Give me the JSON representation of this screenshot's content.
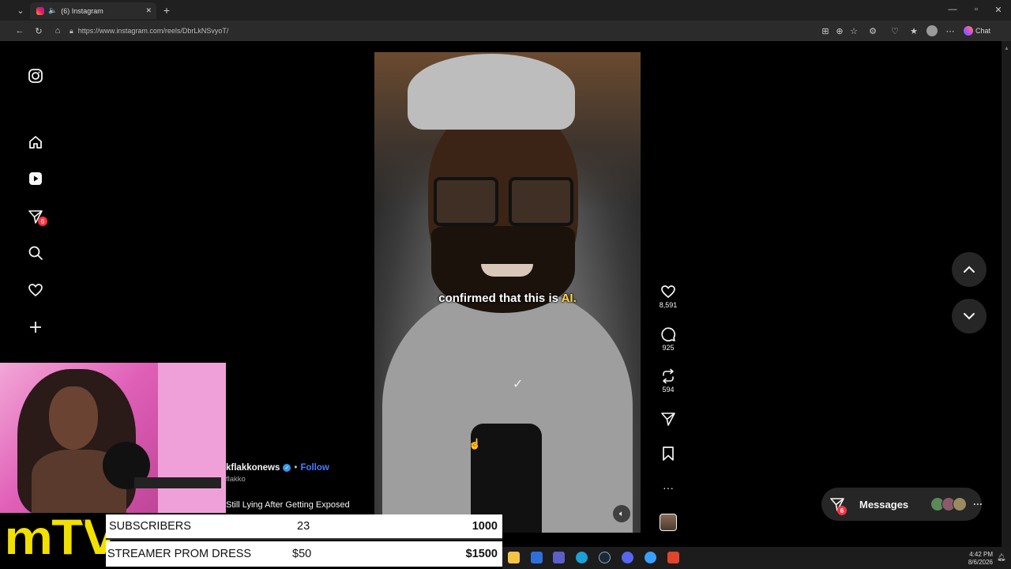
{
  "browser": {
    "tab_title": "(6) Instagram",
    "new_tab_label": "+",
    "url": "https://www.instagram.com/reels/DbrLkNSvyoT/",
    "chat_label": "Chat"
  },
  "sidebar": {
    "notifications_badge": "6"
  },
  "video": {
    "caption_pre": "confirmed that this is ",
    "caption_highlight": "AI."
  },
  "actions": {
    "likes": "8,591",
    "comments": "925",
    "reposts": "594"
  },
  "post": {
    "username": "kflakkonews",
    "follow_label": "Follow",
    "subtitle": "flakko",
    "title": "Still Lying After Getting Exposed"
  },
  "messages": {
    "label": "Messages",
    "badge": "6"
  },
  "stream": {
    "logo": "mTV",
    "goals": [
      {
        "label": "SUBSCRIBERS",
        "current": "23",
        "target": "1000"
      },
      {
        "label": "STREAMER PROM DRESS",
        "current": "$50",
        "target": "$1500"
      }
    ]
  },
  "taskbar": {
    "time": "4:42 PM",
    "date": "8/6/2026"
  },
  "colors": {
    "accent_follow": "#4a7bff",
    "badge_red": "#ff3040",
    "caption_highlight": "#ffd54a",
    "logo_yellow": "#f2e000"
  }
}
